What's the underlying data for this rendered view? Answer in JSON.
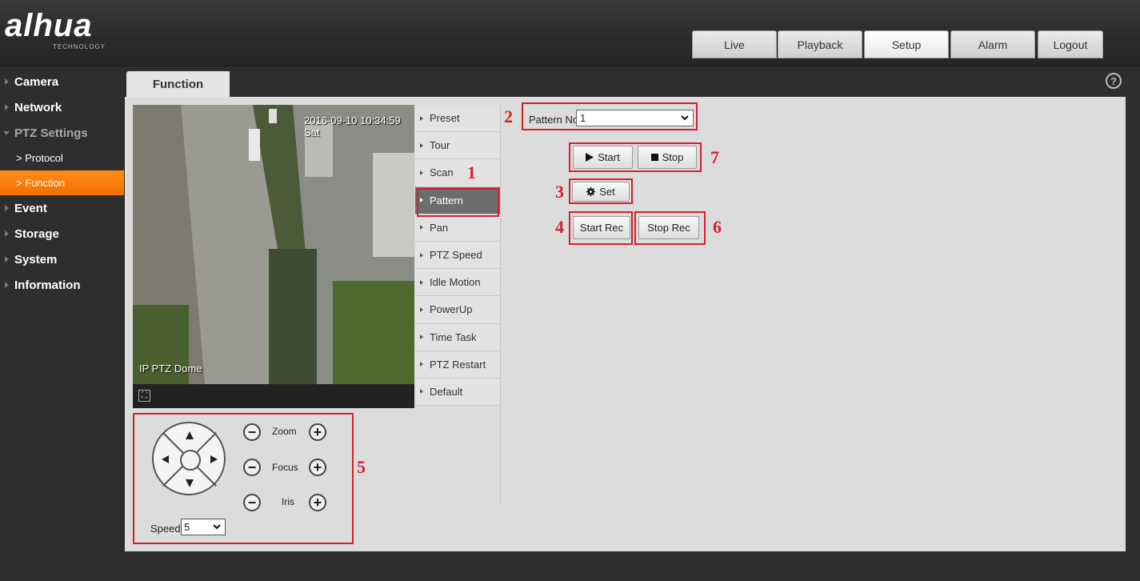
{
  "brand": {
    "logo": "alhua",
    "tagline": "TECHNOLOGY"
  },
  "nav_tabs": [
    {
      "label": "Live"
    },
    {
      "label": "Playback"
    },
    {
      "label": "Setup",
      "active": true
    },
    {
      "label": "Alarm"
    },
    {
      "label": "Logout"
    }
  ],
  "sidebar": {
    "items": [
      {
        "label": "Camera"
      },
      {
        "label": "Network"
      },
      {
        "label": "PTZ Settings",
        "expanded": true
      },
      {
        "label": "> Protocol"
      },
      {
        "label": "> Function",
        "active": true
      },
      {
        "label": "Event"
      },
      {
        "label": "Storage"
      },
      {
        "label": "System"
      },
      {
        "label": "Information"
      }
    ]
  },
  "page_tab": "Function",
  "help_icon": "?",
  "video": {
    "timestamp": "2016-09-10 10:34:59 Sat",
    "camera_name": "IP PTZ Dome",
    "fullscreen_icon": "fullscreen-icon"
  },
  "function_menu": [
    {
      "label": "Preset"
    },
    {
      "label": "Tour"
    },
    {
      "label": "Scan"
    },
    {
      "label": "Pattern",
      "active": true
    },
    {
      "label": "Pan"
    },
    {
      "label": "PTZ Speed"
    },
    {
      "label": "Idle Motion"
    },
    {
      "label": "PowerUp"
    },
    {
      "label": "Time Task"
    },
    {
      "label": "PTZ Restart"
    },
    {
      "label": "Default"
    }
  ],
  "pattern": {
    "label": "Pattern No.",
    "value": "1",
    "start": "Start",
    "stop": "Stop",
    "set": "Set",
    "start_rec": "Start Rec",
    "stop_rec": "Stop Rec"
  },
  "ptz_controls": {
    "zoom": "Zoom",
    "focus": "Focus",
    "iris": "Iris",
    "speed_label": "Speed",
    "speed_value": "5",
    "minus": "−",
    "plus": "+"
  },
  "annotations": [
    "1",
    "2",
    "3",
    "4",
    "5",
    "6",
    "7"
  ],
  "colors": {
    "accent": "#f07000",
    "highlight": "#d4202a",
    "active_menu": "#6d6d6d"
  }
}
